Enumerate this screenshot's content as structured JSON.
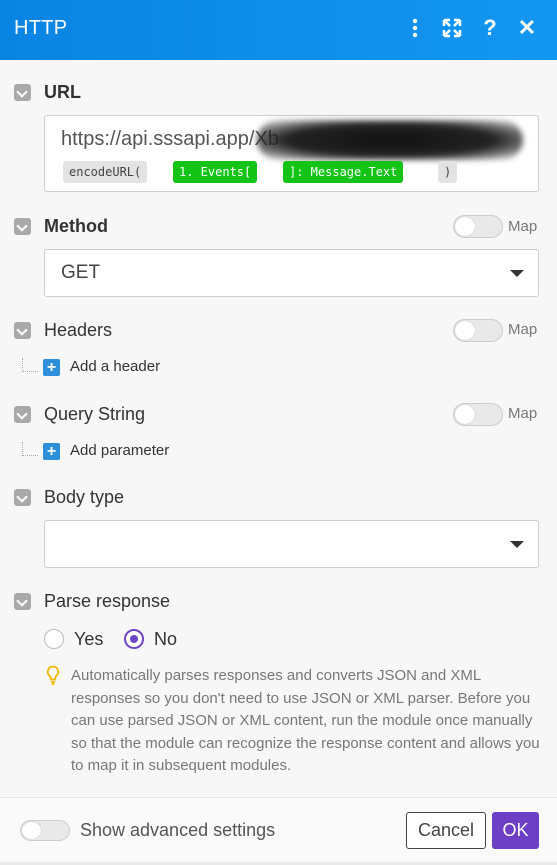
{
  "header": {
    "title": "HTTP"
  },
  "url": {
    "label": "URL",
    "value": "https://api.sssapi.app/Xb",
    "tokens": [
      "encodeURL(",
      "1. Events[",
      "]: Message.Text",
      ")"
    ]
  },
  "method": {
    "label": "Method",
    "map_label": "Map",
    "value": "GET"
  },
  "headers": {
    "label": "Headers",
    "map_label": "Map",
    "add_label": "Add a header"
  },
  "query": {
    "label": "Query String",
    "map_label": "Map",
    "add_label": "Add parameter"
  },
  "body_type": {
    "label": "Body type",
    "value": ""
  },
  "parse": {
    "label": "Parse response",
    "options": [
      "Yes",
      "No"
    ],
    "selected": "No",
    "hint": "Automatically parses responses and converts JSON and XML responses so you don't need to use JSON or XML parser. Before you can use parsed JSON or XML content, run the module once manually so that the module can recognize the response content and allows you to map it in subsequent modules."
  },
  "footer": {
    "advanced_label": "Show advanced settings",
    "cancel_label": "Cancel",
    "ok_label": "OK"
  },
  "colors": {
    "header": "#0b8ae6",
    "accent": "#6d3fc4",
    "token_green": "#13c416"
  },
  "icons": [
    "more-vertical-icon",
    "expand-icon",
    "help-icon",
    "close-icon",
    "lightbulb-icon",
    "plus-icon"
  ]
}
